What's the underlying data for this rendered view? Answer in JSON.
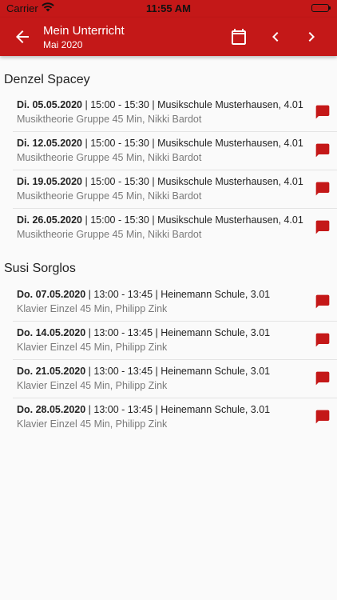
{
  "status_bar": {
    "carrier": "Carrier",
    "time": "11:55 AM"
  },
  "app_bar": {
    "title": "Mein Unterricht",
    "subtitle": "Mai 2020"
  },
  "colors": {
    "primary": "#c41818"
  },
  "icons": [
    "back-arrow-icon",
    "calendar-icon",
    "chevron-left-icon",
    "chevron-right-icon",
    "message-icon",
    "wifi-icon",
    "battery-icon"
  ],
  "students": [
    {
      "name": "Denzel Spacey",
      "lessons": [
        {
          "date": "Di. 05.05.2020",
          "details": " | 15:00 - 15:30 | Musikschule Musterhausen, 4.01",
          "info": "Musiktheorie Gruppe 45 Min, Nikki Bardot"
        },
        {
          "date": "Di. 12.05.2020",
          "details": " | 15:00 - 15:30 | Musikschule Musterhausen, 4.01",
          "info": "Musiktheorie Gruppe 45 Min, Nikki Bardot"
        },
        {
          "date": "Di. 19.05.2020",
          "details": " | 15:00 - 15:30 | Musikschule Musterhausen, 4.01",
          "info": "Musiktheorie Gruppe 45 Min, Nikki Bardot"
        },
        {
          "date": "Di. 26.05.2020",
          "details": " | 15:00 - 15:30 | Musikschule Musterhausen, 4.01",
          "info": "Musiktheorie Gruppe 45 Min, Nikki Bardot"
        }
      ]
    },
    {
      "name": "Susi Sorglos",
      "lessons": [
        {
          "date": "Do. 07.05.2020",
          "details": " | 13:00 - 13:45 | Heinemann Schule, 3.01",
          "info": "Klavier Einzel 45 Min, Philipp Zink"
        },
        {
          "date": "Do. 14.05.2020",
          "details": " | 13:00 - 13:45 | Heinemann Schule, 3.01",
          "info": "Klavier Einzel 45 Min, Philipp Zink"
        },
        {
          "date": "Do. 21.05.2020",
          "details": " | 13:00 - 13:45 | Heinemann Schule, 3.01",
          "info": "Klavier Einzel 45 Min, Philipp Zink"
        },
        {
          "date": "Do. 28.05.2020",
          "details": " | 13:00 - 13:45 | Heinemann Schule, 3.01",
          "info": "Klavier Einzel 45 Min, Philipp Zink"
        }
      ]
    }
  ]
}
